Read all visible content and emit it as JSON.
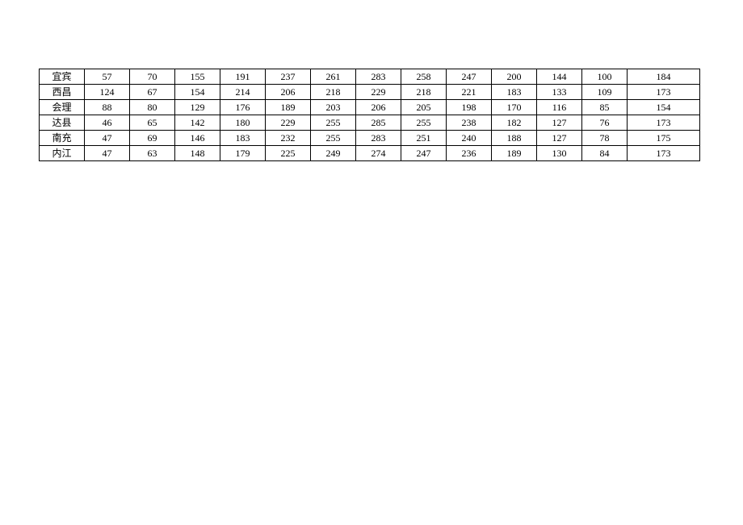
{
  "chart_data": {
    "type": "table",
    "rows": [
      {
        "name": "宜宾",
        "values": [
          57,
          70,
          155,
          191,
          237,
          261,
          283,
          258,
          247,
          200,
          144,
          100,
          184
        ]
      },
      {
        "name": "西昌",
        "values": [
          124,
          67,
          154,
          214,
          206,
          218,
          229,
          218,
          221,
          183,
          133,
          109,
          173
        ]
      },
      {
        "name": "会理",
        "values": [
          88,
          80,
          129,
          176,
          189,
          203,
          206,
          205,
          198,
          170,
          116,
          85,
          154
        ]
      },
      {
        "name": "达县",
        "values": [
          46,
          65,
          142,
          180,
          229,
          255,
          285,
          255,
          238,
          182,
          127,
          76,
          173
        ]
      },
      {
        "name": "南充",
        "values": [
          47,
          69,
          146,
          183,
          232,
          255,
          283,
          251,
          240,
          188,
          127,
          78,
          175
        ]
      },
      {
        "name": "内江",
        "values": [
          47,
          63,
          148,
          179,
          225,
          249,
          274,
          247,
          236,
          189,
          130,
          84,
          173
        ]
      }
    ]
  }
}
